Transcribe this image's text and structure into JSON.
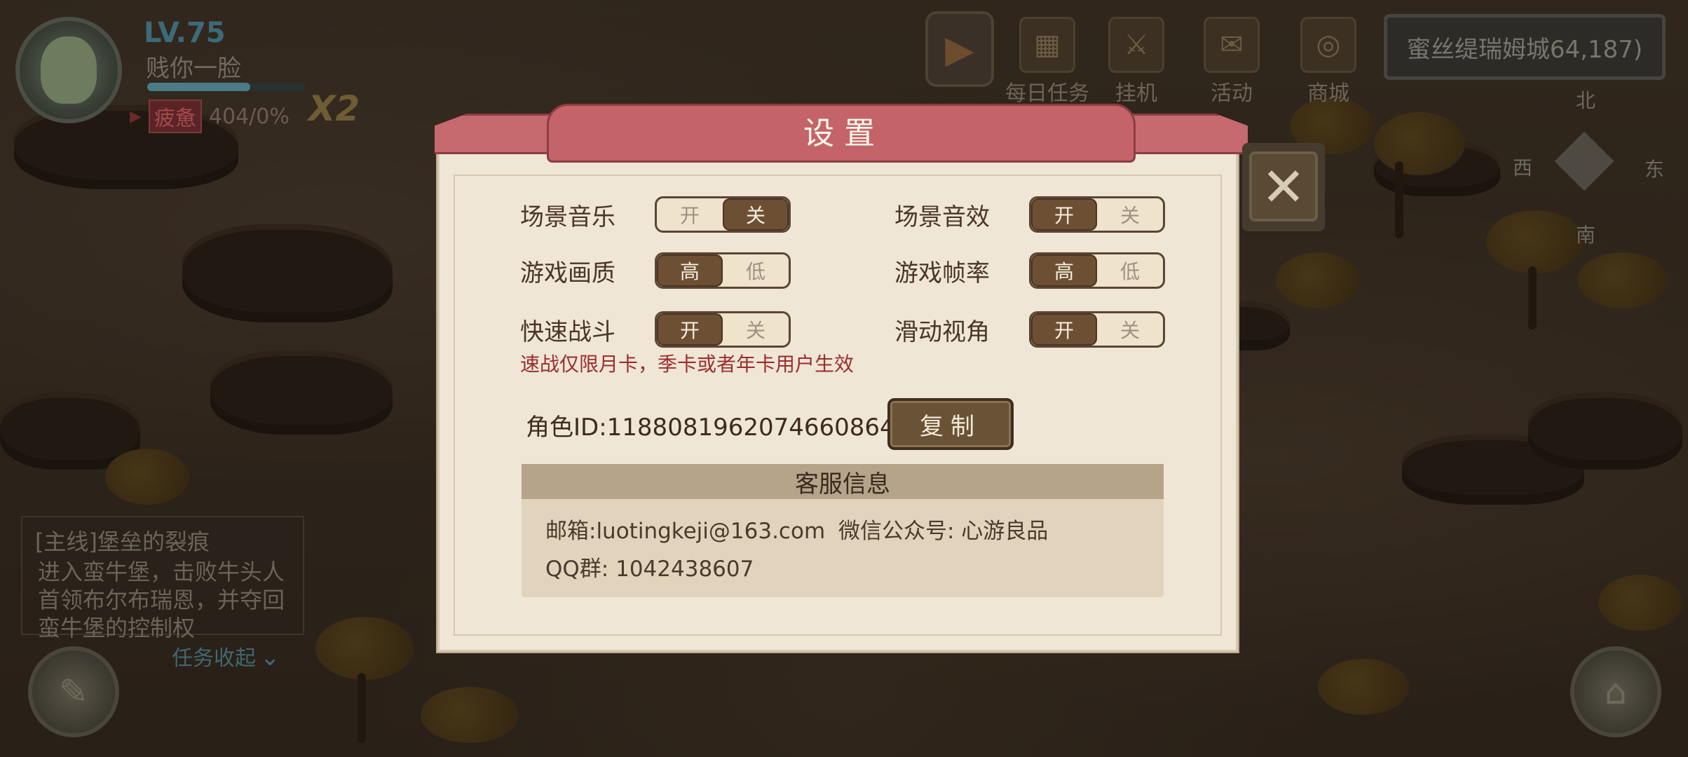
{
  "hud": {
    "level": "LV.75",
    "player_name": "贱你一脸",
    "status_tag": "疲惫",
    "status_value": "404/0%",
    "multiplier": "X2",
    "exp_progress": 0.65
  },
  "top_menu": [
    {
      "label": "每日任务",
      "icon": "calendar-icon"
    },
    {
      "label": "挂机",
      "icon": "crossed-swords-icon"
    },
    {
      "label": "活动",
      "icon": "scroll-icon"
    },
    {
      "label": "商城",
      "icon": "gold-coins-icon"
    }
  ],
  "location": "蜜丝缇瑞姆城64,187)",
  "compass": {
    "north": "北",
    "south": "南",
    "east": "东",
    "west": "西"
  },
  "quest": {
    "title": "[主线]堡垒的裂痕",
    "description": "进入蛮牛堡，击败牛头人首领布尔布瑞恩，并夺回蛮牛堡的控制权",
    "collapse_label": "任务收起"
  },
  "dialog": {
    "title": "设置",
    "settings": [
      {
        "label": "场景音乐",
        "options": [
          "开",
          "关"
        ],
        "selected": 1
      },
      {
        "label": "场景音效",
        "options": [
          "开",
          "关"
        ],
        "selected": 0
      },
      {
        "label": "游戏画质",
        "options": [
          "高",
          "低"
        ],
        "selected": 0
      },
      {
        "label": "游戏帧率",
        "options": [
          "高",
          "低"
        ],
        "selected": 0
      },
      {
        "label": "快速战斗",
        "options": [
          "开",
          "关"
        ],
        "selected": 0
      },
      {
        "label": "滑动视角",
        "options": [
          "开",
          "关"
        ],
        "selected": 0
      }
    ],
    "fast_battle_note": "速战仅限月卡，季卡或者年卡用户生效",
    "role_id": "角色ID:1188081962074660864",
    "copy_label": "复制",
    "customer_service": {
      "header": "客服信息",
      "email": "邮箱:luotingkeji@163.com",
      "wechat": "微信公众号: 心游良品",
      "qq": "QQ群: 1042438607"
    }
  },
  "colors": {
    "ribbon": "#c66a6f",
    "toggle_on": "#6d5034",
    "note_red": "#9a2e2e",
    "panel": "#efe6d6"
  }
}
